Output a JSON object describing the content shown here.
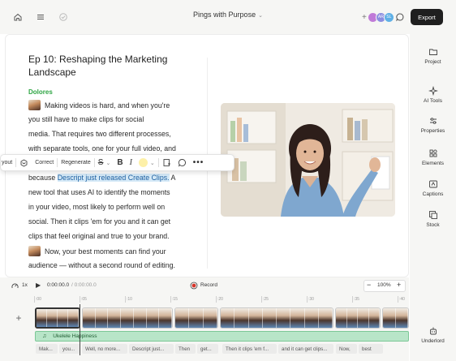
{
  "header": {
    "project_title": "Pings with Purpose",
    "export_label": "Export",
    "avatars": [
      {
        "initials": "",
        "color": "#c07ad8"
      },
      {
        "initials": "AR",
        "color": "#8a8ee0"
      },
      {
        "initials": "SL",
        "color": "#5fb0e6"
      }
    ]
  },
  "editor": {
    "title": "Ep 10: Reshaping the Marketing Landscape",
    "speaker": "Dolores",
    "script_lines": [
      {
        "pre": "Making videos is hard, and when you're",
        "hl": "",
        "post": "",
        "thumb": true
      },
      {
        "pre": "you still have to make clips for social",
        "hl": "",
        "post": "",
        "thumb": false
      },
      {
        "pre": "media. That requires two different processes,",
        "hl": "",
        "post": "",
        "thumb": false
      },
      {
        "pre": "with separate tools, one for your full video, and",
        "hl": "",
        "post": "",
        "thumb": false
      },
      {
        "pre": "because ",
        "hl": "Descript just released Create Clips.",
        "post": " A",
        "thumb": false
      },
      {
        "pre": "new tool that uses AI to identify the moments",
        "hl": "",
        "post": "",
        "thumb": false
      },
      {
        "pre": "in your video, most likely to perform well on",
        "hl": "",
        "post": "",
        "thumb": false
      },
      {
        "pre": "social. Then it clips 'em for you and it can get",
        "hl": "",
        "post": "",
        "thumb": false
      },
      {
        "pre": "clips that feel original and true to your brand.",
        "hl": "",
        "post": "",
        "thumb": false
      },
      {
        "pre": "Now, your best moments can find your",
        "hl": "",
        "post": "",
        "thumb": true
      },
      {
        "pre": "audience — without a second round of editing.",
        "hl": "",
        "post": "",
        "thumb": false
      }
    ]
  },
  "toolbar": {
    "layout_label": "yout",
    "correct_label": "Correct",
    "regenerate_label": "Regenerate",
    "bold_label": "B",
    "italic_label": "I"
  },
  "right_panel": {
    "items": [
      "Project",
      "AI Tools",
      "Properties",
      "Elements",
      "Captions",
      "Stock"
    ],
    "bottom_item": "Underlord"
  },
  "timeline": {
    "speed": "1x",
    "timecode": "0:00:00.0",
    "duration": "/ 0:00:00.0",
    "record_label": "Record",
    "zoom": "100%",
    "ruler_ticks": [
      ":00",
      ":05",
      ":10",
      ":15",
      ":20",
      ":25",
      ":30",
      ":35",
      ":40"
    ],
    "audio_track": "Ukelele Happiness",
    "captions": [
      "Mak...",
      "you...",
      "Well, no more...",
      "Descript just...",
      "Then",
      "get...",
      "Then it clips 'em f...",
      "and it can get clips...",
      "Now,",
      "best"
    ]
  }
}
